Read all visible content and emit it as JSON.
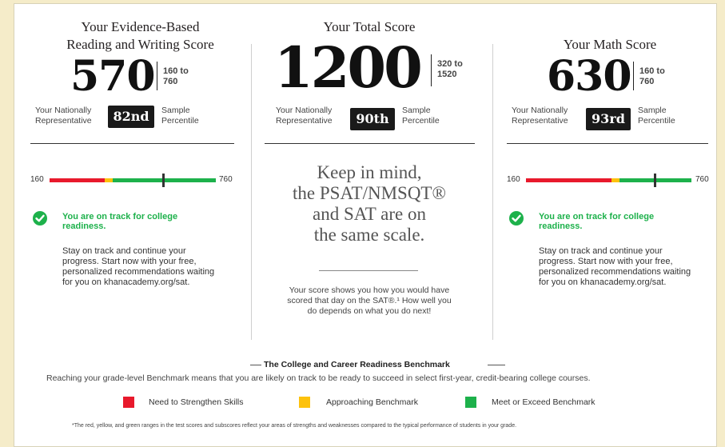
{
  "rw": {
    "title_line1": "Your Evidence-Based",
    "title_line2": "Reading and Writing Score",
    "score": "570",
    "range_line1": "160 to",
    "range_line2": "760",
    "pct_left_1": "Your Nationally",
    "pct_left_2": "Representative",
    "percentile": "82nd",
    "pct_right_1": "Sample",
    "pct_right_2": "Percentile",
    "scale_min": "160",
    "scale_max": "760",
    "score_value": 570,
    "track_line1": "You are on track for college",
    "track_line2": "readiness.",
    "advice_lines": [
      "Stay on track and continue your",
      "progress. Start now with your free,",
      "personalized recommendations waiting",
      "for you on khanacademy.org/sat."
    ]
  },
  "total": {
    "title": "Your Total Score",
    "score": "1200",
    "range_line1": "320 to",
    "range_line2": "1520",
    "pct_left_1": "Your Nationally",
    "pct_left_2": "Representative",
    "percentile": "90th",
    "pct_right_1": "Sample",
    "pct_right_2": "Percentile",
    "keep_lines": [
      "Keep in mind,",
      "the PSAT/NMSQT®",
      "and SAT are on",
      "the same scale."
    ],
    "note_lines": [
      "Your score shows you how you would have",
      "scored that day on the SAT®.¹ How well you",
      "do depends on what you do next!"
    ]
  },
  "math": {
    "title": "Your Math Score",
    "score": "630",
    "range_line1": "160 to",
    "range_line2": "760",
    "pct_left_1": "Your Nationally",
    "pct_left_2": "Representative",
    "percentile": "93rd",
    "pct_right_1": "Sample",
    "pct_right_2": "Percentile",
    "scale_min": "160",
    "scale_max": "760",
    "score_value": 630,
    "track_line1": "You are on track for college",
    "track_line2": "readiness.",
    "advice_lines": [
      "Stay on track and continue your",
      "progress. Start now with your free,",
      "personalized recommendations waiting",
      "for you on khanacademy.org/sat."
    ]
  },
  "benchmark": {
    "title": "The College and Career Readiness Benchmark",
    "description": "Reaching your grade-level Benchmark means that you are likely on track to be ready to succeed in select first-year, credit-bearing college courses.",
    "legend": [
      {
        "label": "Need to Strengthen Skills",
        "color": "#e8192c"
      },
      {
        "label": "Approaching Benchmark",
        "color": "#fdc20d"
      },
      {
        "label": "Meet or Exceed Benchmark",
        "color": "#1db14b"
      }
    ],
    "footnote": "*The red, yellow, and green ranges in the test scores and subscores reflect your areas of strengths and weaknesses compared to the typical performance of students in your grade."
  },
  "colors": {
    "red": "#e8192c",
    "yellow": "#fdc20d",
    "green": "#1db14b"
  }
}
